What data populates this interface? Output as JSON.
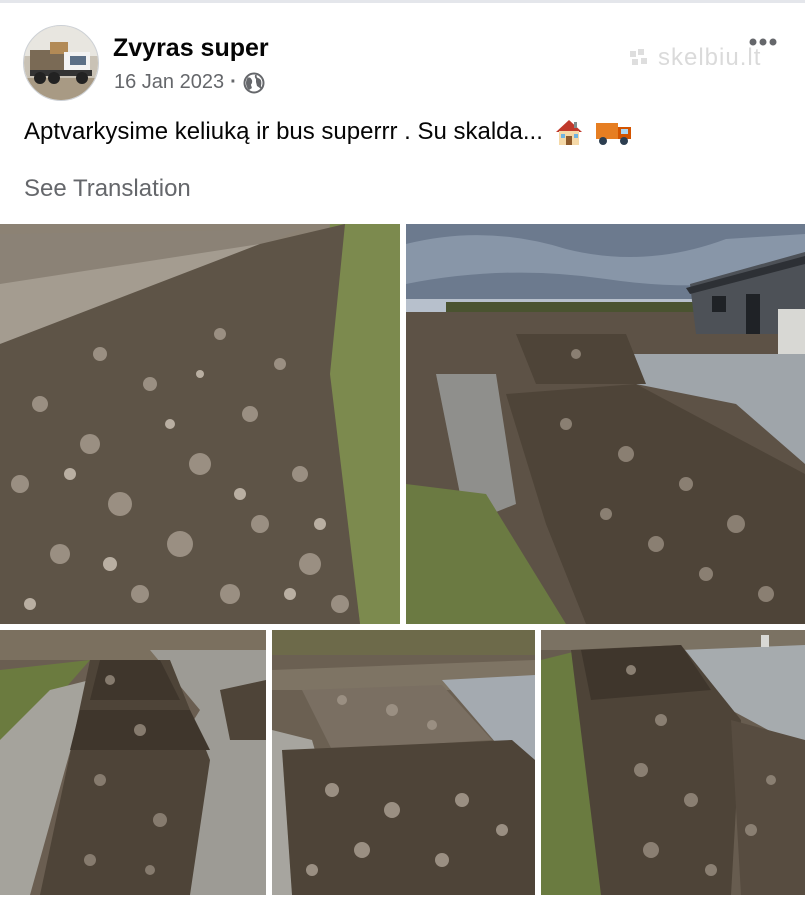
{
  "post": {
    "author": "Zvyras super",
    "date": "16 Jan 2023",
    "separator": "·",
    "audience_icon": "globe-icon",
    "text": "Aptvarkysime keliuką ir bus superrr . Su skalda...",
    "text_emojis": [
      "house-icon",
      "delivery-truck-icon"
    ],
    "see_translation": "See Translation",
    "watermark": "skelbiu.lt"
  },
  "photos": [
    {
      "name": "gravel-pile-road-photo"
    },
    {
      "name": "muddy-road-house-photo"
    },
    {
      "name": "muddy-track-gravel-photo"
    },
    {
      "name": "gravel-heaps-water-photo"
    },
    {
      "name": "gravel-road-field-photo"
    }
  ],
  "colors": {
    "text": "#050505",
    "secondary": "#65676b",
    "background": "#ffffff"
  }
}
